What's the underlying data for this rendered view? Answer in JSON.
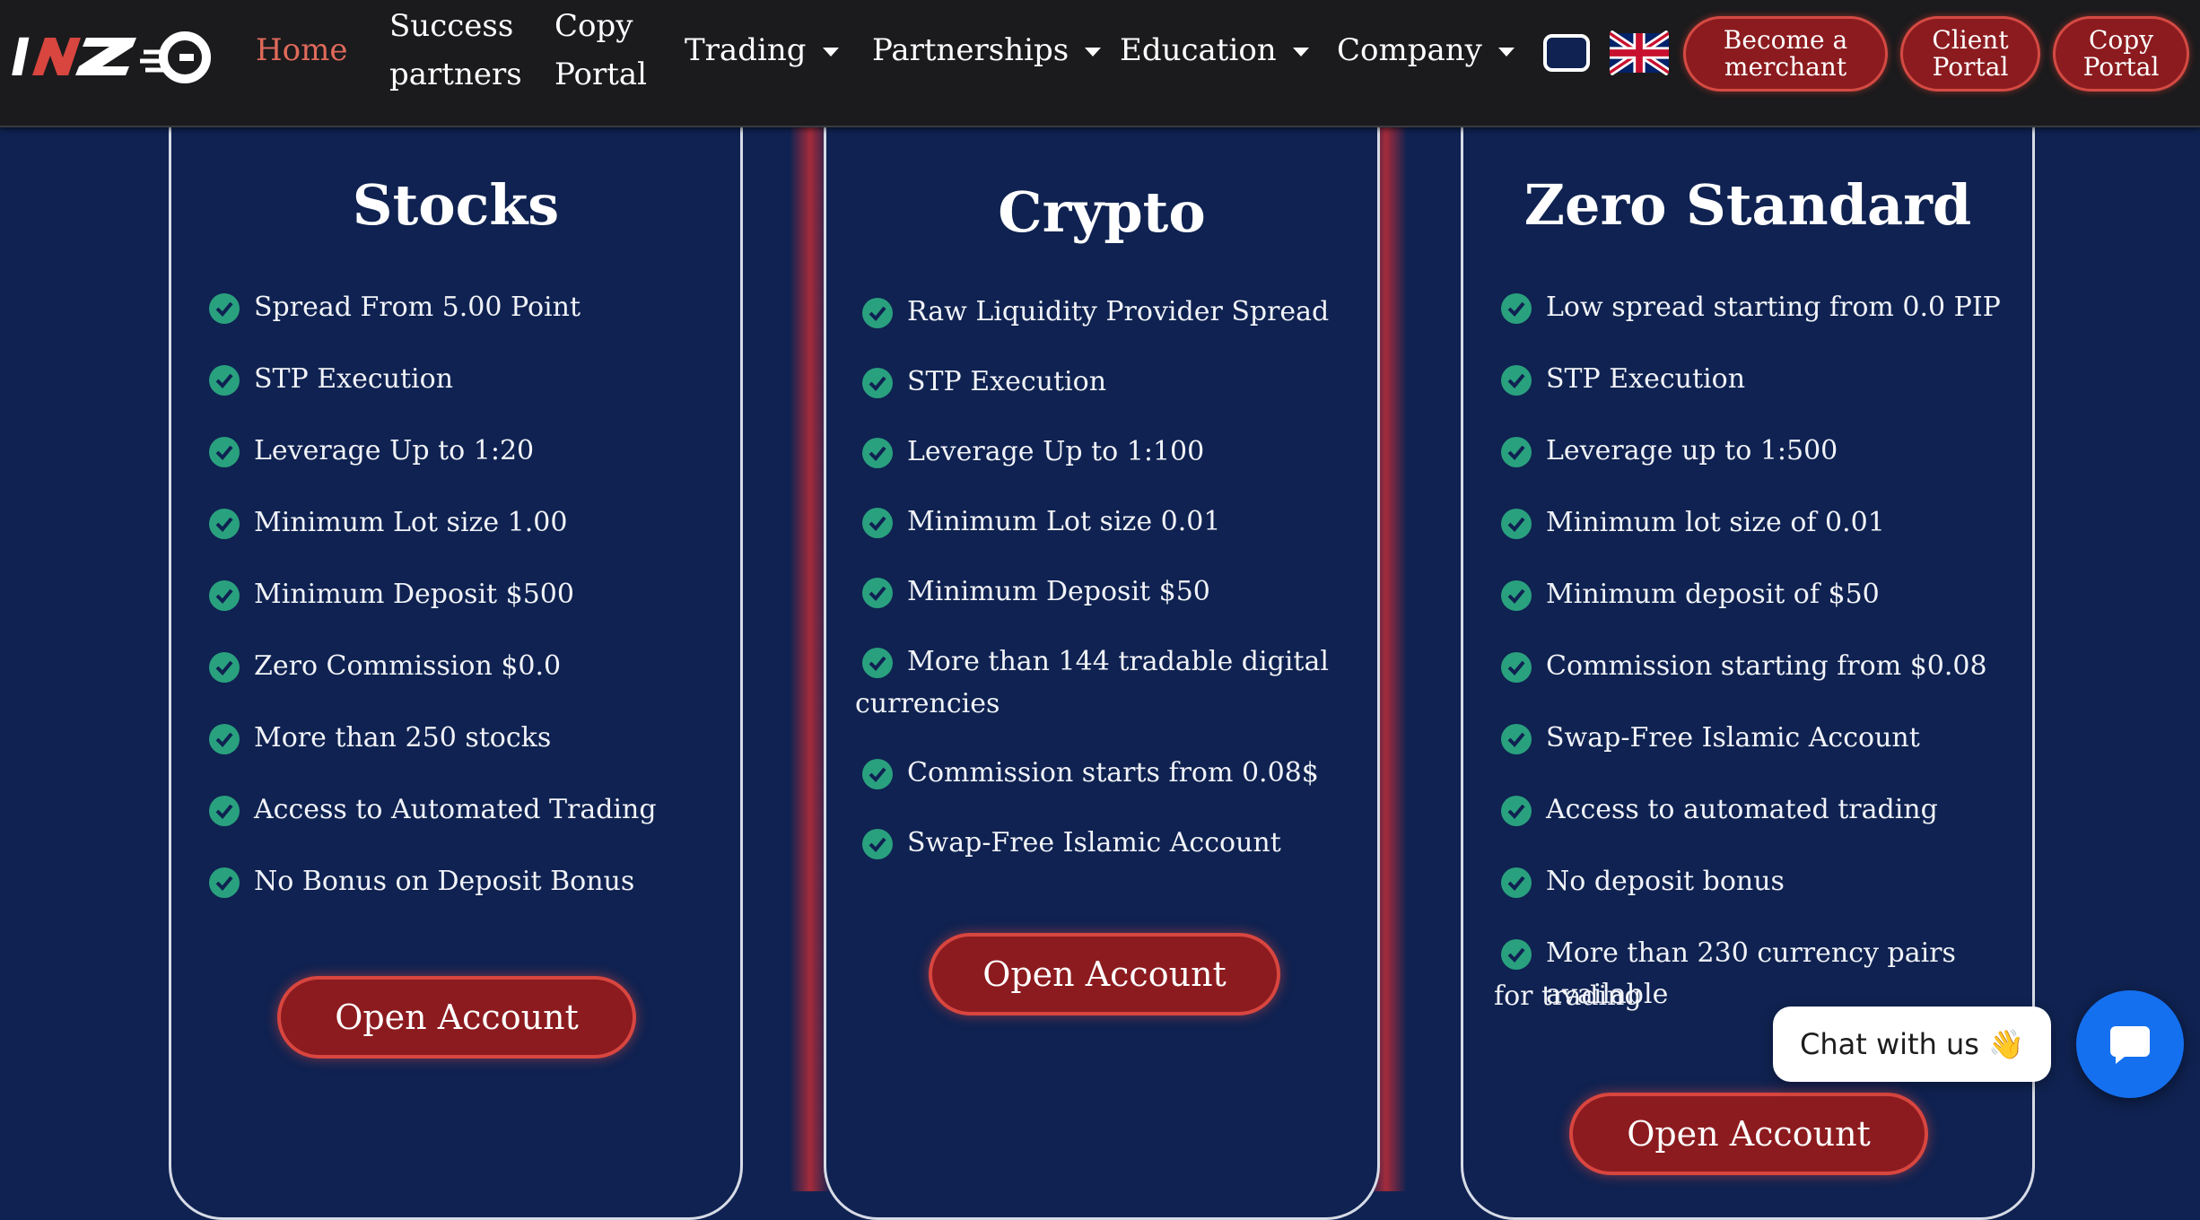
{
  "nav": {
    "logo_text": "INZO",
    "home": "Home",
    "success_partners": [
      "Success",
      "partners"
    ],
    "copy_portal": [
      "Copy",
      "Portal"
    ],
    "trading": "Trading",
    "partnerships": "Partnerships",
    "education": "Education",
    "company": "Company",
    "become_merchant": [
      "Become a",
      "merchant"
    ],
    "client_portal": [
      "Client",
      "Portal"
    ],
    "copy_portal_btn": [
      "Copy",
      "Portal"
    ]
  },
  "cards": [
    {
      "title": "Stocks",
      "features": [
        "Spread From 5.00 Point",
        "STP Execution",
        "Leverage Up to 1:20",
        "Minimum Lot size 1.00",
        "Minimum Deposit $500",
        "Zero Commission $0.0",
        "More than 250 stocks",
        "Access to Automated Trading",
        "No Bonus on Deposit Bonus"
      ],
      "button": "Open Account"
    },
    {
      "title": "Crypto",
      "features": [
        "Raw Liquidity Provider Spread",
        "STP Execution",
        "Leverage Up to 1:100",
        "Minimum Lot size 0.01",
        "Minimum Deposit $50",
        [
          "More than 144 tradable digital",
          "currencies"
        ],
        "Commission starts from 0.08$",
        "Swap-Free Islamic Account"
      ],
      "button": "Open Account"
    },
    {
      "title": "Zero Standard",
      "features": [
        "Low spread starting from 0.0 PIP",
        "STP Execution",
        "Leverage up to 1:500",
        "Minimum lot size of 0.01",
        "Minimum deposit of $50",
        "Commission starting from $0.08",
        "Swap-Free Islamic Account",
        "Access to automated trading",
        "No deposit bonus",
        [
          "More than 230 currency pairs available",
          "for trading"
        ]
      ],
      "button": "Open Account"
    }
  ],
  "chat": {
    "label": "Chat with us 👋"
  },
  "colors": {
    "background": "#0f2251",
    "navbar": "#1b1b1d",
    "accent_red": "#8c1b1f",
    "check_green": "#2aa17e",
    "home_link": "#e06a5b",
    "chat_blue": "#1570ef"
  },
  "icons": [
    "logo-icon",
    "theme-toggle-icon",
    "uk-flag-icon",
    "check-circle-icon",
    "chat-icon",
    "waving-hand-icon"
  ]
}
